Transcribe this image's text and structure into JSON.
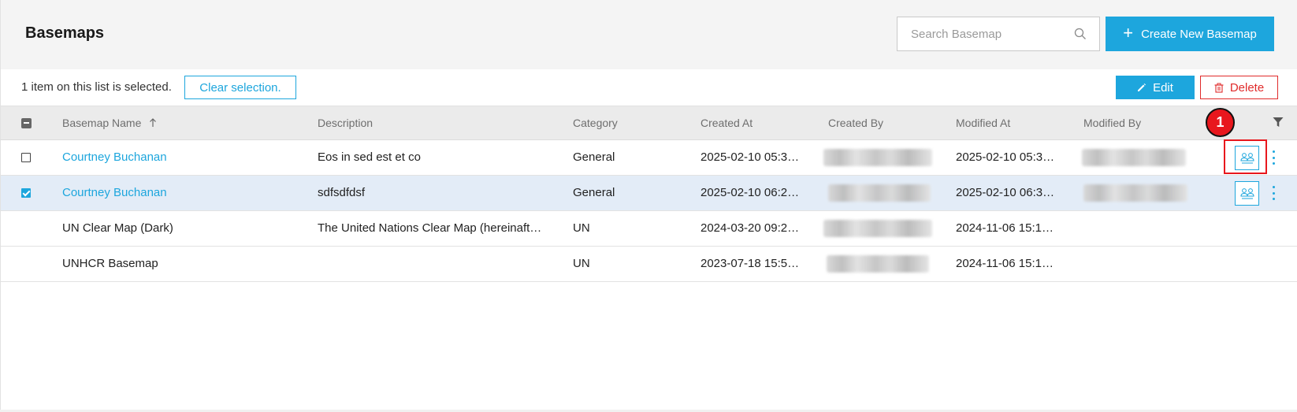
{
  "header": {
    "title": "Basemaps",
    "search_placeholder": "Search Basemap",
    "create_label": "Create New Basemap",
    "search_icon": "search-icon",
    "plus_icon": "plus-icon"
  },
  "selection": {
    "text": "1 item on this list is selected.",
    "clear_label": "Clear selection.",
    "edit_label": "Edit",
    "delete_label": "Delete"
  },
  "table": {
    "columns": {
      "name": "Basemap Name",
      "description": "Description",
      "category": "Category",
      "created_at": "Created At",
      "created_by": "Created By",
      "modified_at": "Modified At",
      "modified_by": "Modified By"
    },
    "rows": [
      {
        "name": "Courtney Buchanan",
        "description": "Eos in sed est et co",
        "category": "General",
        "created_at": "2025-02-10 05:3…",
        "modified_at": "2025-02-10 05:3…",
        "checked": false
      },
      {
        "name": "Courtney Buchanan",
        "description": "sdfsdfdsf",
        "category": "General",
        "created_at": "2025-02-10 06:2…",
        "modified_at": "2025-02-10 06:3…",
        "checked": true
      },
      {
        "name": "UN Clear Map (Dark)",
        "description": "The United Nations Clear Map (hereinaft…",
        "category": "UN",
        "created_at": "2024-03-20 09:2…",
        "modified_at": "2024-11-06 15:1…"
      },
      {
        "name": "UNHCR Basemap",
        "description": "",
        "category": "UN",
        "created_at": "2023-07-18 15:5…",
        "modified_at": "2024-11-06 15:1…"
      }
    ]
  },
  "annotation": {
    "label": "1"
  },
  "colors": {
    "accent": "#1da6dd",
    "danger": "#e02b2b",
    "annotation": "#e8171d",
    "selected_row": "#e3ecf7"
  }
}
